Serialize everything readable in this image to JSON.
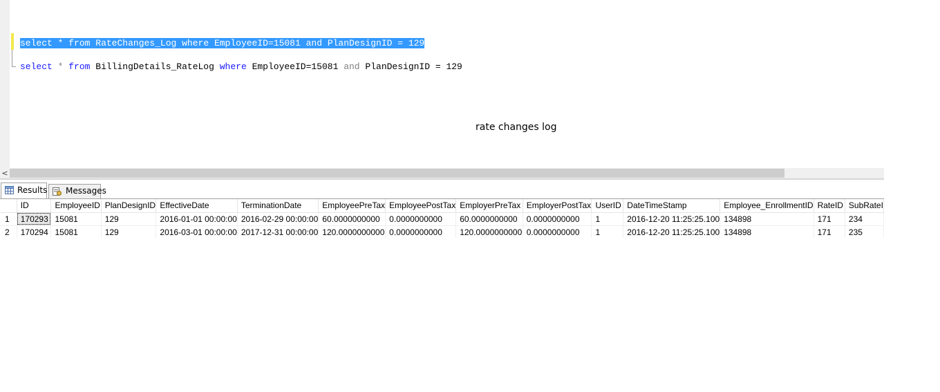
{
  "editor": {
    "line1": {
      "kw_select": "select",
      "star": "*",
      "kw_from": "from",
      "table": "RateChanges_Log",
      "kw_where": "where",
      "cond1": "EmployeeID=15081",
      "kw_and": "and",
      "cond2": "PlanDesignID = 129"
    },
    "line2": {
      "kw_select": "select",
      "star": "*",
      "kw_from": "from",
      "table": "BillingDetails_RateLog",
      "kw_where": "where",
      "cond1": "EmployeeID=15081",
      "kw_and": "and",
      "cond2": "PlanDesignID = 129"
    },
    "annotation": "rate changes log"
  },
  "scrollbar": {
    "left_arrow": "<"
  },
  "tabs": [
    {
      "label": "Results",
      "icon": "grid-icon",
      "active": true
    },
    {
      "label": "Messages",
      "icon": "messages-icon",
      "active": false
    }
  ],
  "grid": {
    "columns": [
      "",
      "ID",
      "EmployeeID",
      "PlanDesignID",
      "EffectiveDate",
      "TerminationDate",
      "EmployeePreTax",
      "EmployeePostTax",
      "EmployerPreTax",
      "EmployerPostTax",
      "UserID",
      "DateTimeStamp",
      "Employee_EnrollmentID",
      "RateID",
      "SubRateI"
    ],
    "rows": [
      [
        "1",
        "170293",
        "15081",
        "129",
        "2016-01-01 00:00:00",
        "2016-02-29 00:00:00",
        "60.0000000000",
        "0.0000000000",
        "60.0000000000",
        "0.0000000000",
        "1",
        "2016-12-20 11:25:25.100",
        "134898",
        "171",
        "234"
      ],
      [
        "2",
        "170294",
        "15081",
        "129",
        "2016-03-01 00:00:00",
        "2017-12-31 00:00:00",
        "120.0000000000",
        "0.0000000000",
        "120.0000000000",
        "0.0000000000",
        "1",
        "2016-12-20 11:25:25.100",
        "134898",
        "171",
        "235"
      ]
    ]
  },
  "colors": {
    "selection": "#3399ff",
    "keyword": "#1a1aff",
    "operator": "#808080",
    "gutter": "#f0f0f0",
    "change_marker": "#f2e84c"
  }
}
